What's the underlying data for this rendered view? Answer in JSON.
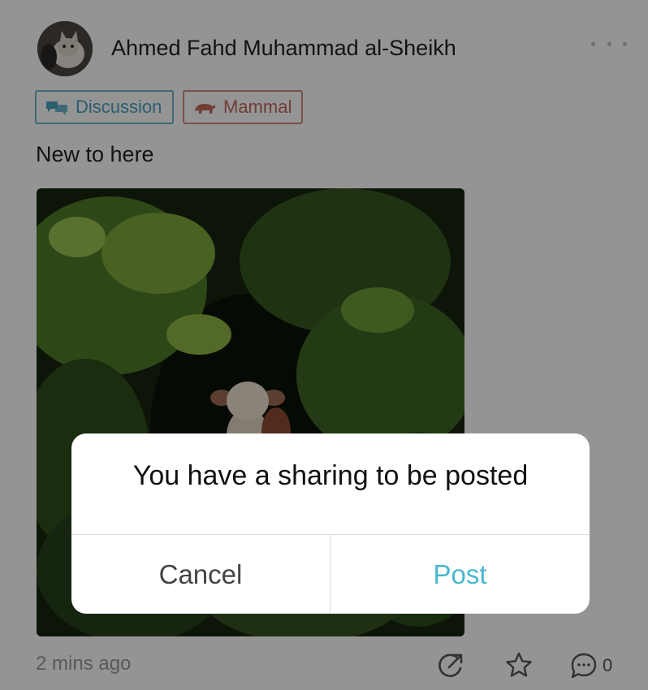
{
  "post": {
    "author": "Ahmed Fahd Muhammad al-Sheikh",
    "tags": [
      {
        "label": "Discussion",
        "icon": "speech-bubbles-icon",
        "color": "#4aa3bf"
      },
      {
        "label": "Mammal",
        "icon": "mammal-icon",
        "color": "#c0695c"
      }
    ],
    "text": "New to here",
    "timestamp": "2 mins ago",
    "comment_count": "0",
    "actions": [
      "share-icon",
      "star-icon",
      "comment-icon"
    ]
  },
  "dialog": {
    "message": "You have a sharing to be posted",
    "cancel_label": "Cancel",
    "post_label": "Post",
    "accent_color": "#49b7cf"
  }
}
